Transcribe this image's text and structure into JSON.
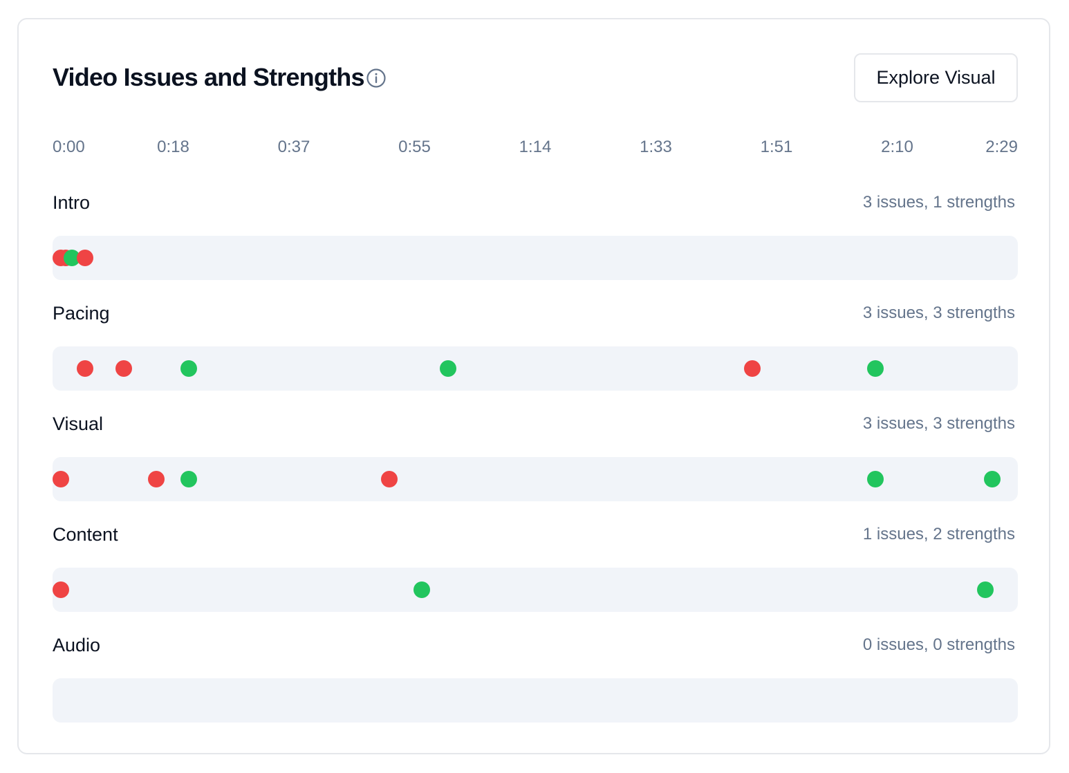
{
  "header": {
    "title": "Video Issues and Strengths",
    "info_icon": "info-circle-icon",
    "explore_button_label": "Explore Visual"
  },
  "colors": {
    "issue": "#ef4444",
    "strength": "#22c55e",
    "track": "#f1f4f9"
  },
  "timeline": {
    "duration_seconds": 149,
    "ticks": [
      "0:00",
      "0:18",
      "0:37",
      "0:55",
      "1:14",
      "1:33",
      "1:51",
      "2:10",
      "2:29"
    ]
  },
  "rows": [
    {
      "label": "Intro",
      "summary": "3 issues, 1 strengths",
      "markers": [
        {
          "type": "issue",
          "t": 1
        },
        {
          "type": "issue",
          "t": 2
        },
        {
          "type": "strength",
          "t": 3
        },
        {
          "type": "issue",
          "t": 5
        }
      ]
    },
    {
      "label": "Pacing",
      "summary": "3 issues, 3 strengths",
      "markers": [
        {
          "type": "issue",
          "t": 5
        },
        {
          "type": "issue",
          "t": 11
        },
        {
          "type": "strength",
          "t": 21
        },
        {
          "type": "strength",
          "t": 61
        },
        {
          "type": "issue",
          "t": 108
        },
        {
          "type": "strength",
          "t": 127
        }
      ]
    },
    {
      "label": "Visual",
      "summary": "3 issues, 3 strengths",
      "markers": [
        {
          "type": "issue",
          "t": 1
        },
        {
          "type": "issue",
          "t": 16
        },
        {
          "type": "strength",
          "t": 21
        },
        {
          "type": "issue",
          "t": 52
        },
        {
          "type": "strength",
          "t": 127
        },
        {
          "type": "strength",
          "t": 145
        }
      ]
    },
    {
      "label": "Content",
      "summary": "1 issues, 2 strengths",
      "markers": [
        {
          "type": "issue",
          "t": 1
        },
        {
          "type": "strength",
          "t": 57
        },
        {
          "type": "strength",
          "t": 144
        }
      ]
    },
    {
      "label": "Audio",
      "summary": "0 issues, 0 strengths",
      "markers": []
    }
  ]
}
